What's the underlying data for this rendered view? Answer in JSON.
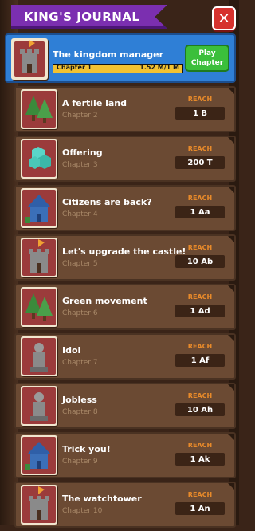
{
  "header": {
    "title": "KING'S JOURNAL",
    "close_label": "✕"
  },
  "current": {
    "title": "The kingdom manager",
    "progress_label": "Chapter 1",
    "progress_value": "1.52 M/1 M",
    "progress_fraction": 1.0,
    "play_label": "Play Chapter",
    "icon": "castle-icon"
  },
  "chapters": [
    {
      "title": "A fertile land",
      "sub": "Chapter 2",
      "reach_label": "REACH",
      "reach_value": "1 B",
      "icon": "trees-icon"
    },
    {
      "title": "Offering",
      "sub": "Chapter 3",
      "reach_label": "REACH",
      "reach_value": "200 T",
      "icon": "gems-icon"
    },
    {
      "title": "Citizens are back?",
      "sub": "Chapter 4",
      "reach_label": "REACH",
      "reach_value": "1 Aa",
      "icon": "house-icon"
    },
    {
      "title": "Let's upgrade the castle!",
      "sub": "Chapter 5",
      "reach_label": "REACH",
      "reach_value": "10 Ab",
      "icon": "castle-icon"
    },
    {
      "title": "Green movement",
      "sub": "Chapter 6",
      "reach_label": "REACH",
      "reach_value": "1 Ad",
      "icon": "trees-icon"
    },
    {
      "title": "Idol",
      "sub": "Chapter 7",
      "reach_label": "REACH",
      "reach_value": "1 Af",
      "icon": "statue-icon"
    },
    {
      "title": "Jobless",
      "sub": "Chapter 8",
      "reach_label": "REACH",
      "reach_value": "10 Ah",
      "icon": "statue-icon"
    },
    {
      "title": "Trick you!",
      "sub": "Chapter 9",
      "reach_label": "REACH",
      "reach_value": "1 Ak",
      "icon": "house-icon"
    },
    {
      "title": "The watchtower",
      "sub": "Chapter 10",
      "reach_label": "REACH",
      "reach_value": "1 An",
      "icon": "castle-icon"
    }
  ],
  "colors": {
    "header_purple": "#7b2fb0",
    "close_red": "#d6322e",
    "current_blue": "#2f7fd6",
    "play_green": "#3bbf3b",
    "row_brown": "#6b4a33",
    "reach_orange": "#e88a2a",
    "progress_yellow": "#f1c232"
  }
}
